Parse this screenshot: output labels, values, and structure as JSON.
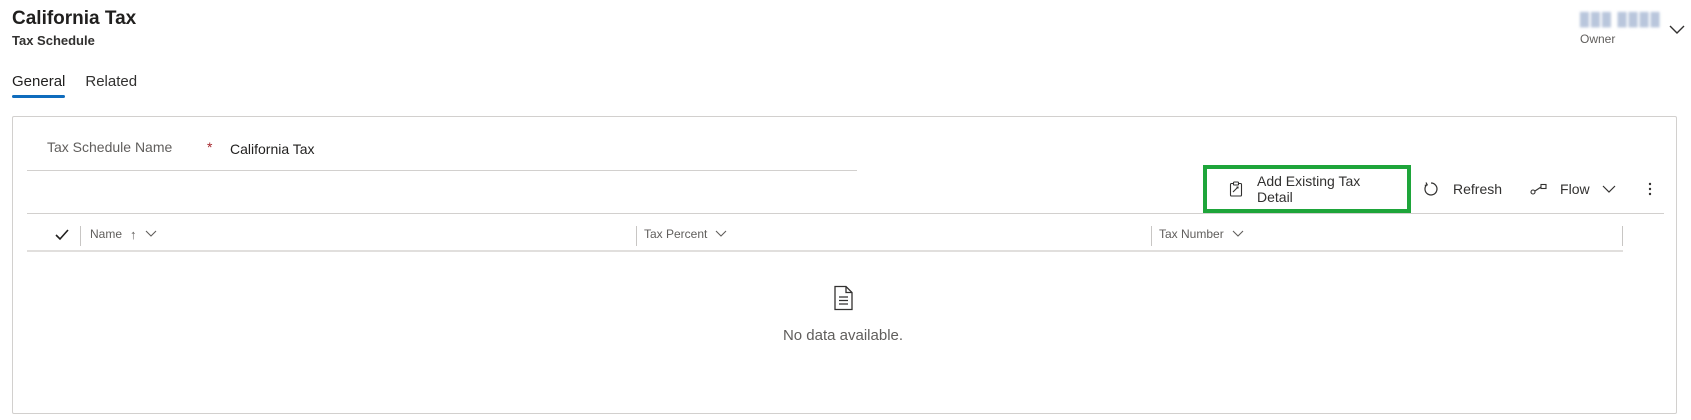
{
  "header": {
    "title": "California Tax",
    "subtitle": "Tax Schedule",
    "owner_name": "▉▉▉ ▉▉▉▉",
    "owner_label": "Owner"
  },
  "tabs": [
    {
      "label": "General",
      "active": true
    },
    {
      "label": "Related",
      "active": false
    }
  ],
  "form": {
    "field_label": "Tax Schedule Name",
    "required_mark": "*",
    "field_value": "California Tax"
  },
  "commands": {
    "add_existing": "Add Existing Tax Detail",
    "refresh": "Refresh",
    "flow": "Flow"
  },
  "grid": {
    "columns": [
      "Name",
      "Tax Percent",
      "Tax Number"
    ],
    "sort_indicator": "↑",
    "empty_message": "No data available."
  },
  "colors": {
    "accent": "#0f6cbd",
    "highlight_border": "#1ea53a",
    "required": "#a4262c"
  },
  "icons": [
    "chevron-down-icon",
    "clipboard-add-icon",
    "refresh-icon",
    "flow-icon",
    "more-vertical-icon",
    "checkmark-icon",
    "document-icon"
  ]
}
